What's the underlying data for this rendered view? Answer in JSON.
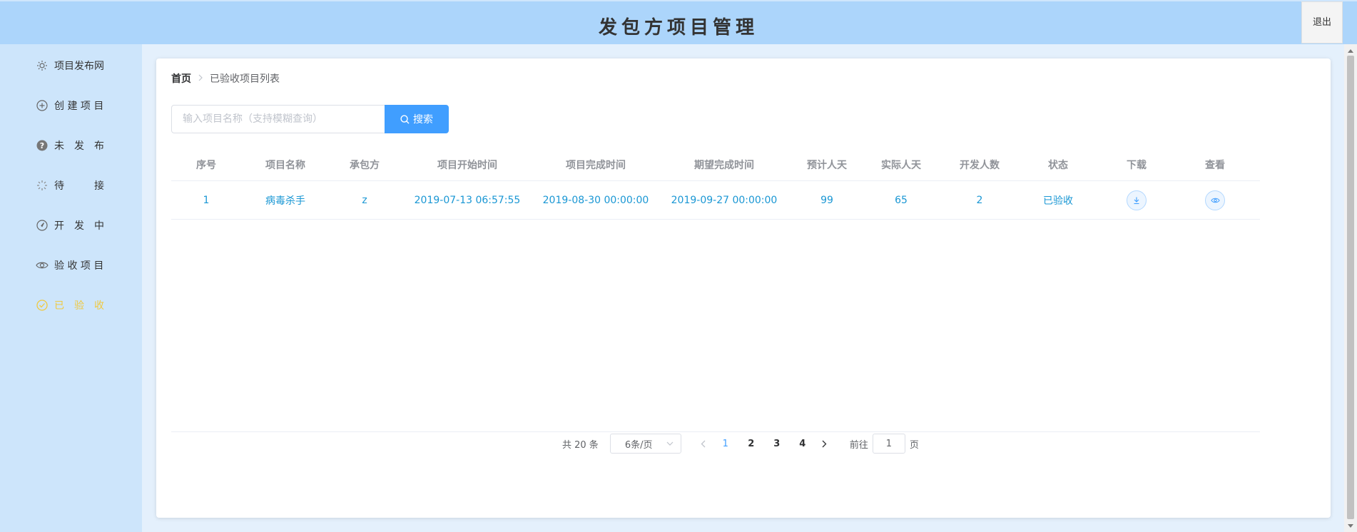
{
  "header": {
    "title": "发包方项目管理",
    "logout_label": "退出"
  },
  "sidebar": {
    "items": [
      {
        "label": "项目发布网",
        "icon": "sun-icon"
      },
      {
        "label": "创 建 项 目",
        "icon": "circle-plus-icon"
      },
      {
        "label": "未　发　布",
        "icon": "question-circle-icon"
      },
      {
        "label": "待　　　接",
        "icon": "loading-icon"
      },
      {
        "label": "开　发　中",
        "icon": "compass-icon"
      },
      {
        "label": "验 收 项 目",
        "icon": "eye-icon"
      },
      {
        "label": "已　验　收",
        "icon": "circle-check-icon",
        "active": true
      }
    ]
  },
  "breadcrumb": {
    "home": "首页",
    "current": "已验收项目列表"
  },
  "search": {
    "placeholder": "输入项目名称（支持模糊查询）",
    "value": "",
    "button_label": "搜索"
  },
  "table": {
    "columns": [
      "序号",
      "项目名称",
      "承包方",
      "项目开始时间",
      "项目完成时间",
      "期望完成时间",
      "预计人天",
      "实际人天",
      "开发人数",
      "状态",
      "下载",
      "查看"
    ],
    "rows": [
      {
        "index": "1",
        "name": "病毒杀手",
        "contractor": "z",
        "start": "2019-07-13 06:57:55",
        "finish": "2019-08-30 00:00:00",
        "expected": "2019-09-27 00:00:00",
        "planned_days": "99",
        "actual_days": "65",
        "developers": "2",
        "status": "已验收"
      }
    ]
  },
  "pagination": {
    "total_text": "共 20 条",
    "page_size": "6条/页",
    "pages": [
      "1",
      "2",
      "3",
      "4"
    ],
    "current": "1",
    "goto_prefix": "前往",
    "goto_value": "1",
    "goto_suffix": "页"
  },
  "colors": {
    "header": "#acd5fb",
    "sidebar": "#cde5fb",
    "accent": "#409eff",
    "active_menu": "#f0c93f",
    "cell_text": "#1a97d4"
  }
}
